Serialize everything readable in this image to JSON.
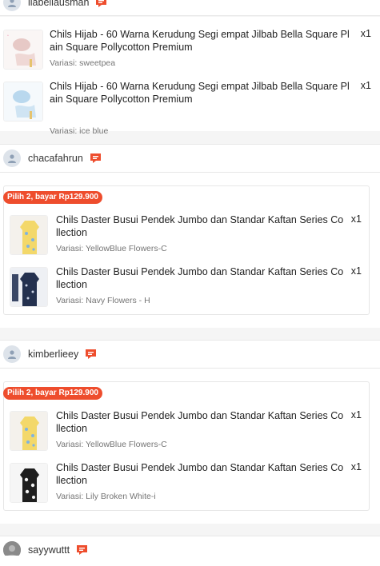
{
  "groups": [
    {
      "username": "liabellausman",
      "items": [
        {
          "title": "Chils Hijab - 60 Warna Kerudung Segi empat Jilbab Bella Square Pl ain Square Pollycotton Premium",
          "variant": "Variasi: sweetpea",
          "qty": "x1"
        },
        {
          "title": "Chils Hijab - 60 Warna Kerudung Segi empat Jilbab Bella Square Pl ain Square Pollycotton Premium",
          "variant": "Variasi: ice blue",
          "qty": "x1"
        }
      ]
    },
    {
      "username": "chacafahrun",
      "bundle": "Pilih 2, bayar Rp129.900",
      "items": [
        {
          "title": "Chils Daster Busui Pendek Jumbo dan Standar Kaftan Series Co llection",
          "variant": "Variasi: YellowBlue Flowers-C",
          "qty": "x1"
        },
        {
          "title": "Chils Daster Busui Pendek Jumbo dan Standar Kaftan Series Co llection",
          "variant": "Variasi: Navy Flowers - H",
          "qty": "x1"
        }
      ]
    },
    {
      "username": "kimberlieey",
      "bundle": "Pilih 2, bayar Rp129.900",
      "items": [
        {
          "title": "Chils Daster Busui Pendek Jumbo dan Standar Kaftan Series Co llection",
          "variant": "Variasi: YellowBlue Flowers-C",
          "qty": "x1"
        },
        {
          "title": "Chils Daster Busui Pendek Jumbo dan Standar Kaftan Series Co llection",
          "variant": "Variasi: Lily Broken White-i",
          "qty": "x1"
        }
      ]
    },
    {
      "username": "sayywuttt"
    }
  ],
  "colors": {
    "accent": "#ee4d2d",
    "chat": "#ee4d2d"
  }
}
